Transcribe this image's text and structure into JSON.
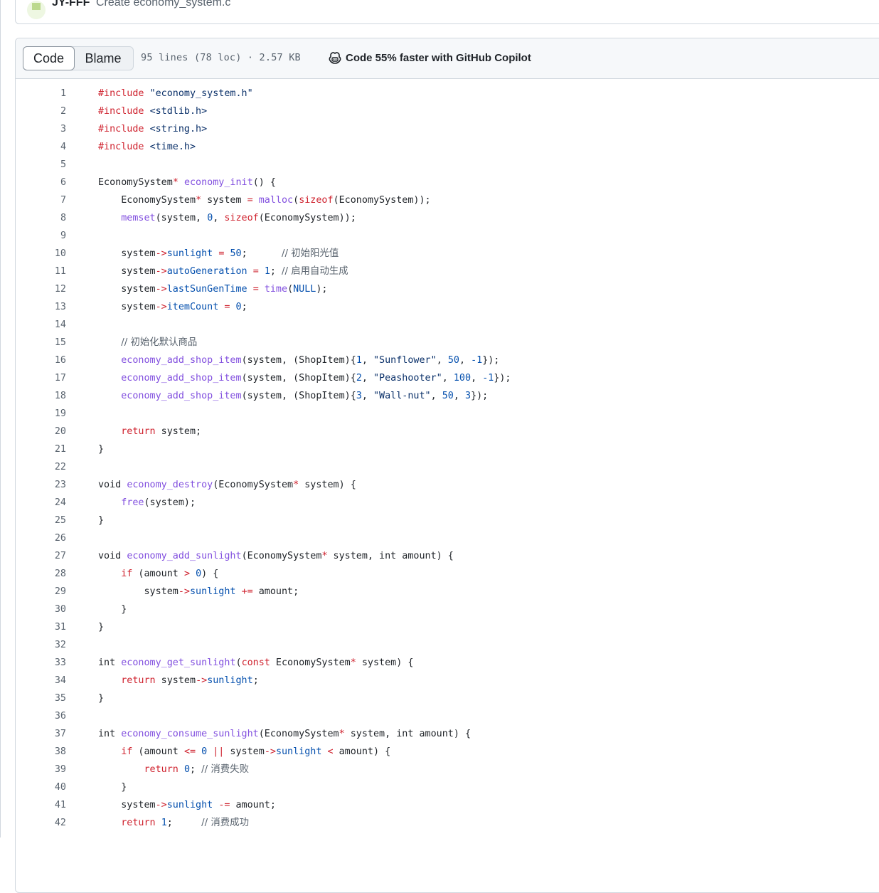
{
  "commit": {
    "author": "JY-FFF",
    "message": "Create economy_system.c"
  },
  "file_header": {
    "tabs": [
      "Code",
      "Blame"
    ],
    "active_tab": "Code",
    "meta": "95 lines (78 loc) · 2.57 KB",
    "copilot_label": "Code 55% faster with GitHub Copilot"
  },
  "code": {
    "lines": [
      {
        "n": "1",
        "parts": [
          [
            "k",
            "#include "
          ],
          [
            "s",
            "\"economy_system.h\""
          ]
        ]
      },
      {
        "n": "2",
        "parts": [
          [
            "k",
            "#include "
          ],
          [
            "s",
            "<stdlib.h>"
          ]
        ]
      },
      {
        "n": "3",
        "parts": [
          [
            "k",
            "#include "
          ],
          [
            "s",
            "<string.h>"
          ]
        ]
      },
      {
        "n": "4",
        "parts": [
          [
            "k",
            "#include "
          ],
          [
            "s",
            "<time.h>"
          ]
        ]
      },
      {
        "n": "5",
        "parts": []
      },
      {
        "n": "6",
        "parts": [
          [
            "p",
            "EconomySystem"
          ],
          [
            "k",
            "*"
          ],
          [
            "p",
            " "
          ],
          [
            "f",
            "economy_init"
          ],
          [
            "p",
            "() {"
          ]
        ]
      },
      {
        "n": "7",
        "parts": [
          [
            "p",
            "    EconomySystem"
          ],
          [
            "k",
            "*"
          ],
          [
            "p",
            " system "
          ],
          [
            "k",
            "="
          ],
          [
            "p",
            " "
          ],
          [
            "f",
            "malloc"
          ],
          [
            "p",
            "("
          ],
          [
            "k",
            "sizeof"
          ],
          [
            "p",
            "(EconomySystem));"
          ]
        ]
      },
      {
        "n": "8",
        "parts": [
          [
            "p",
            "    "
          ],
          [
            "f",
            "memset"
          ],
          [
            "p",
            "(system, "
          ],
          [
            "t",
            "0"
          ],
          [
            "p",
            ", "
          ],
          [
            "k",
            "sizeof"
          ],
          [
            "p",
            "(EconomySystem));"
          ]
        ]
      },
      {
        "n": "9",
        "parts": []
      },
      {
        "n": "10",
        "parts": [
          [
            "p",
            "    system"
          ],
          [
            "k",
            "->"
          ],
          [
            "t",
            "sunlight"
          ],
          [
            "p",
            " "
          ],
          [
            "k",
            "="
          ],
          [
            "p",
            " "
          ],
          [
            "t",
            "50"
          ],
          [
            "p",
            ";      "
          ],
          [
            "c",
            "// 初始阳光值"
          ]
        ]
      },
      {
        "n": "11",
        "parts": [
          [
            "p",
            "    system"
          ],
          [
            "k",
            "->"
          ],
          [
            "t",
            "autoGeneration"
          ],
          [
            "p",
            " "
          ],
          [
            "k",
            "="
          ],
          [
            "p",
            " "
          ],
          [
            "t",
            "1"
          ],
          [
            "p",
            "; "
          ],
          [
            "c",
            "// 启用自动生成"
          ]
        ]
      },
      {
        "n": "12",
        "parts": [
          [
            "p",
            "    system"
          ],
          [
            "k",
            "->"
          ],
          [
            "t",
            "lastSunGenTime"
          ],
          [
            "p",
            " "
          ],
          [
            "k",
            "="
          ],
          [
            "p",
            " "
          ],
          [
            "f",
            "time"
          ],
          [
            "p",
            "("
          ],
          [
            "t",
            "NULL"
          ],
          [
            "p",
            ");"
          ]
        ]
      },
      {
        "n": "13",
        "parts": [
          [
            "p",
            "    system"
          ],
          [
            "k",
            "->"
          ],
          [
            "t",
            "itemCount"
          ],
          [
            "p",
            " "
          ],
          [
            "k",
            "="
          ],
          [
            "p",
            " "
          ],
          [
            "t",
            "0"
          ],
          [
            "p",
            ";"
          ]
        ]
      },
      {
        "n": "14",
        "parts": []
      },
      {
        "n": "15",
        "parts": [
          [
            "p",
            "    "
          ],
          [
            "c",
            "// 初始化默认商品"
          ]
        ]
      },
      {
        "n": "16",
        "parts": [
          [
            "p",
            "    "
          ],
          [
            "f",
            "economy_add_shop_item"
          ],
          [
            "p",
            "(system, (ShopItem){"
          ],
          [
            "t",
            "1"
          ],
          [
            "p",
            ", "
          ],
          [
            "s",
            "\"Sunflower\""
          ],
          [
            "p",
            ", "
          ],
          [
            "t",
            "50"
          ],
          [
            "p",
            ", "
          ],
          [
            "t",
            "-1"
          ],
          [
            "p",
            "});"
          ]
        ]
      },
      {
        "n": "17",
        "parts": [
          [
            "p",
            "    "
          ],
          [
            "f",
            "economy_add_shop_item"
          ],
          [
            "p",
            "(system, (ShopItem){"
          ],
          [
            "t",
            "2"
          ],
          [
            "p",
            ", "
          ],
          [
            "s",
            "\"Peashooter\""
          ],
          [
            "p",
            ", "
          ],
          [
            "t",
            "100"
          ],
          [
            "p",
            ", "
          ],
          [
            "t",
            "-1"
          ],
          [
            "p",
            "});"
          ]
        ]
      },
      {
        "n": "18",
        "parts": [
          [
            "p",
            "    "
          ],
          [
            "f",
            "economy_add_shop_item"
          ],
          [
            "p",
            "(system, (ShopItem){"
          ],
          [
            "t",
            "3"
          ],
          [
            "p",
            ", "
          ],
          [
            "s",
            "\"Wall-nut\""
          ],
          [
            "p",
            ", "
          ],
          [
            "t",
            "50"
          ],
          [
            "p",
            ", "
          ],
          [
            "t",
            "3"
          ],
          [
            "p",
            "});"
          ]
        ]
      },
      {
        "n": "19",
        "parts": []
      },
      {
        "n": "20",
        "parts": [
          [
            "p",
            "    "
          ],
          [
            "k",
            "return"
          ],
          [
            "p",
            " system;"
          ]
        ]
      },
      {
        "n": "21",
        "parts": [
          [
            "p",
            "}"
          ]
        ]
      },
      {
        "n": "22",
        "parts": []
      },
      {
        "n": "23",
        "parts": [
          [
            "p",
            "void "
          ],
          [
            "f",
            "economy_destroy"
          ],
          [
            "p",
            "(EconomySystem"
          ],
          [
            "k",
            "*"
          ],
          [
            "p",
            " system) {"
          ]
        ]
      },
      {
        "n": "24",
        "parts": [
          [
            "p",
            "    "
          ],
          [
            "f",
            "free"
          ],
          [
            "p",
            "(system);"
          ]
        ]
      },
      {
        "n": "25",
        "parts": [
          [
            "p",
            "}"
          ]
        ]
      },
      {
        "n": "26",
        "parts": []
      },
      {
        "n": "27",
        "parts": [
          [
            "p",
            "void "
          ],
          [
            "f",
            "economy_add_sunlight"
          ],
          [
            "p",
            "(EconomySystem"
          ],
          [
            "k",
            "*"
          ],
          [
            "p",
            " system, int amount) {"
          ]
        ]
      },
      {
        "n": "28",
        "parts": [
          [
            "p",
            "    "
          ],
          [
            "k",
            "if"
          ],
          [
            "p",
            " (amount "
          ],
          [
            "k",
            ">"
          ],
          [
            "p",
            " "
          ],
          [
            "t",
            "0"
          ],
          [
            "p",
            ") {"
          ]
        ]
      },
      {
        "n": "29",
        "parts": [
          [
            "p",
            "        system"
          ],
          [
            "k",
            "->"
          ],
          [
            "t",
            "sunlight"
          ],
          [
            "p",
            " "
          ],
          [
            "k",
            "+="
          ],
          [
            "p",
            " amount;"
          ]
        ]
      },
      {
        "n": "30",
        "parts": [
          [
            "p",
            "    }"
          ]
        ]
      },
      {
        "n": "31",
        "parts": [
          [
            "p",
            "}"
          ]
        ]
      },
      {
        "n": "32",
        "parts": []
      },
      {
        "n": "33",
        "parts": [
          [
            "p",
            "int "
          ],
          [
            "f",
            "economy_get_sunlight"
          ],
          [
            "p",
            "("
          ],
          [
            "k",
            "const"
          ],
          [
            "p",
            " EconomySystem"
          ],
          [
            "k",
            "*"
          ],
          [
            "p",
            " system) {"
          ]
        ]
      },
      {
        "n": "34",
        "parts": [
          [
            "p",
            "    "
          ],
          [
            "k",
            "return"
          ],
          [
            "p",
            " system"
          ],
          [
            "k",
            "->"
          ],
          [
            "t",
            "sunlight"
          ],
          [
            "p",
            ";"
          ]
        ]
      },
      {
        "n": "35",
        "parts": [
          [
            "p",
            "}"
          ]
        ]
      },
      {
        "n": "36",
        "parts": []
      },
      {
        "n": "37",
        "parts": [
          [
            "p",
            "int "
          ],
          [
            "f",
            "economy_consume_sunlight"
          ],
          [
            "p",
            "(EconomySystem"
          ],
          [
            "k",
            "*"
          ],
          [
            "p",
            " system, int amount) {"
          ]
        ]
      },
      {
        "n": "38",
        "parts": [
          [
            "p",
            "    "
          ],
          [
            "k",
            "if"
          ],
          [
            "p",
            " (amount "
          ],
          [
            "k",
            "<="
          ],
          [
            "p",
            " "
          ],
          [
            "t",
            "0"
          ],
          [
            "p",
            " "
          ],
          [
            "k",
            "||"
          ],
          [
            "p",
            " system"
          ],
          [
            "k",
            "->"
          ],
          [
            "t",
            "sunlight"
          ],
          [
            "p",
            " "
          ],
          [
            "k",
            "<"
          ],
          [
            "p",
            " amount) {"
          ]
        ]
      },
      {
        "n": "39",
        "parts": [
          [
            "p",
            "        "
          ],
          [
            "k",
            "return"
          ],
          [
            "p",
            " "
          ],
          [
            "t",
            "0"
          ],
          [
            "p",
            "; "
          ],
          [
            "c",
            "// 消费失败"
          ]
        ]
      },
      {
        "n": "40",
        "parts": [
          [
            "p",
            "    }"
          ]
        ]
      },
      {
        "n": "41",
        "parts": [
          [
            "p",
            "    system"
          ],
          [
            "k",
            "->"
          ],
          [
            "t",
            "sunlight"
          ],
          [
            "p",
            " "
          ],
          [
            "k",
            "-="
          ],
          [
            "p",
            " amount;"
          ]
        ]
      },
      {
        "n": "42",
        "parts": [
          [
            "p",
            "    "
          ],
          [
            "k",
            "return"
          ],
          [
            "p",
            " "
          ],
          [
            "t",
            "1"
          ],
          [
            "p",
            ";     "
          ],
          [
            "c",
            "// 消费成功"
          ]
        ]
      }
    ]
  }
}
